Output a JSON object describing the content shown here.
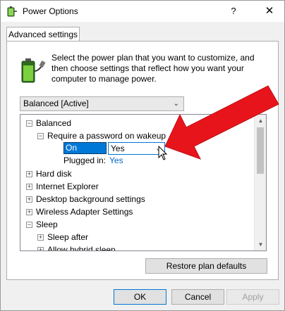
{
  "window": {
    "title": "Power Options",
    "help_glyph": "?",
    "close_glyph": "✕"
  },
  "tabs": [
    {
      "label": "Advanced settings"
    }
  ],
  "description": "Select the power plan that you want to customize, and then choose settings that reflect how you want your computer to manage power.",
  "plan_select": {
    "value": "Balanced [Active]"
  },
  "tree": {
    "items": [
      {
        "label": "Balanced",
        "expander": "−"
      },
      {
        "label": "Require a password on wakeup",
        "expander": "−"
      },
      {
        "label": "Hard disk",
        "expander": "+"
      },
      {
        "label": "Internet Explorer",
        "expander": "+"
      },
      {
        "label": "Desktop background settings",
        "expander": "+"
      },
      {
        "label": "Wireless Adapter Settings",
        "expander": "+"
      },
      {
        "label": "Sleep",
        "expander": "−"
      },
      {
        "label": "Sleep after",
        "expander": "+"
      },
      {
        "label": "Allow hybrid sleep",
        "expander": "+"
      }
    ],
    "on_battery": {
      "label": "On battery:",
      "value": "Yes"
    },
    "plugged_in": {
      "label": "Plugged in:",
      "value": "Yes"
    }
  },
  "buttons": {
    "restore": "Restore plan defaults",
    "ok": "OK",
    "cancel": "Cancel",
    "apply": "Apply"
  },
  "colors": {
    "selection": "#0078d7",
    "link_value": "#0066cc",
    "annotation_arrow": "#e8141b"
  },
  "icons": {
    "title": "power-options-icon",
    "battery": "battery-plug-icon",
    "cursor": "mouse-pointer-icon"
  }
}
